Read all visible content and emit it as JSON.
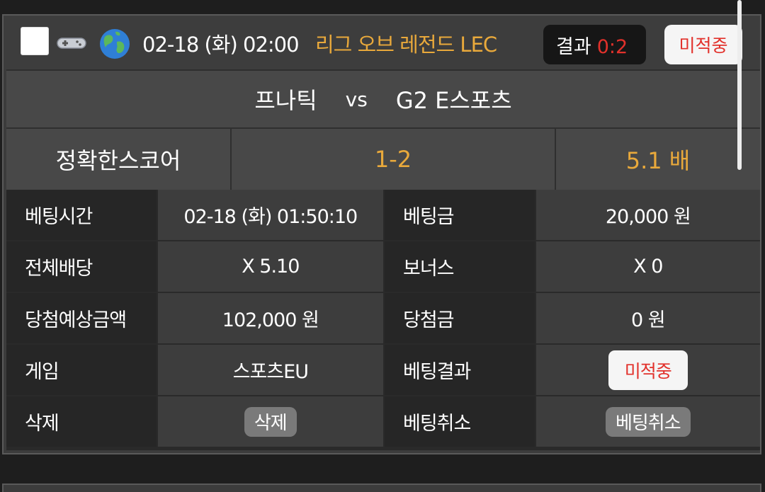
{
  "header": {
    "datetime": "02-18 (화) 02:00",
    "league": "리그 오브 레전드 LEC",
    "result_label": "결과",
    "result_value": "0:2",
    "status": "미적중",
    "icons": [
      "checkbox",
      "gamepad-icon",
      "globe-icon"
    ]
  },
  "match": {
    "home": "프나틱",
    "vs": "vs",
    "away": "G2 E스포츠"
  },
  "pick": {
    "type": "정확한스코어",
    "score": "1-2",
    "odds": "5.1 배"
  },
  "details": {
    "bet_time_label": "베팅시간",
    "bet_time": "02-18 (화) 01:50:10",
    "bet_amount_label": "베팅금",
    "bet_amount": "20,000 원",
    "total_odds_label": "전체배당",
    "total_odds": "X 5.10",
    "bonus_label": "보너스",
    "bonus": "X 0",
    "expected_win_label": "당첨예상금액",
    "expected_win": "102,000 원",
    "win_amount_label": "당첨금",
    "win_amount": "0 원",
    "game_label": "게임",
    "game": "스포츠EU",
    "bet_result_label": "베팅결과",
    "bet_result": "미적중",
    "delete_label": "삭제",
    "delete_button": "삭제",
    "cancel_label": "베팅취소",
    "cancel_button": "베팅취소"
  },
  "colors": {
    "accent_orange": "#e9a93b",
    "loss_red": "#e2312b",
    "background": "#1e1e1e"
  }
}
